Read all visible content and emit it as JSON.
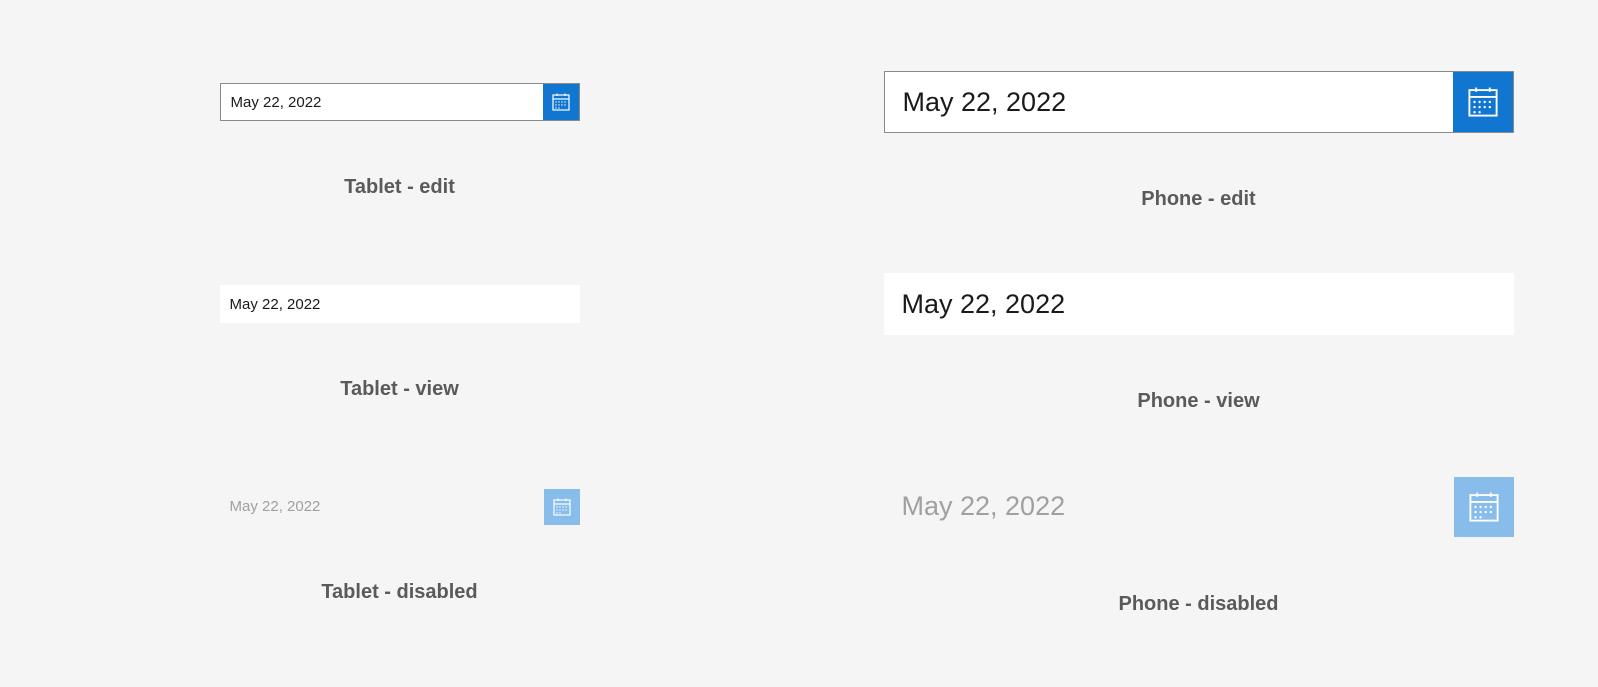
{
  "date_value": "May 22, 2022",
  "captions": {
    "tablet_edit": "Tablet - edit",
    "phone_edit": "Phone - edit",
    "tablet_view": "Tablet - view",
    "phone_view": "Phone - view",
    "tablet_disabled": "Tablet - disabled",
    "phone_disabled": "Phone - disabled"
  }
}
